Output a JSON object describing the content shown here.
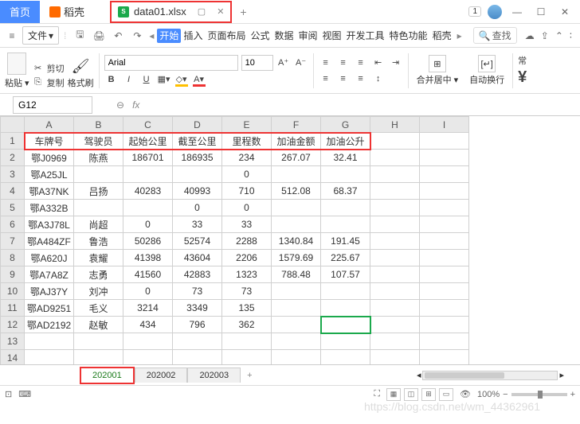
{
  "titlebar": {
    "home_tab": "首页",
    "docer_tab": "稻壳",
    "file_tab": "data01.xlsx",
    "badge": "1"
  },
  "menubar": {
    "file_menu": "文件",
    "tabs": [
      "开始",
      "插入",
      "页面布局",
      "公式",
      "数据",
      "审阅",
      "视图",
      "开发工具",
      "特色功能",
      "稻壳"
    ],
    "active_tab_index": 0,
    "search_label": "查找"
  },
  "ribbon": {
    "paste": "粘贴",
    "cut": "剪切",
    "copy": "复制",
    "format_painter": "格式刷",
    "font_name": "Arial",
    "font_size": "10",
    "merge_center": "合并居中",
    "auto_wrap": "自动换行",
    "general": "常"
  },
  "formula_bar": {
    "name_box": "G12"
  },
  "sheet": {
    "columns": [
      "A",
      "B",
      "C",
      "D",
      "E",
      "F",
      "G",
      "H",
      "I"
    ],
    "rows_shown": 15,
    "active_cell": {
      "row": 12,
      "col": "G"
    },
    "headers": [
      "车牌号",
      "驾驶员",
      "起始公里",
      "截至公里",
      "里程数",
      "加油金额",
      "加油公升"
    ],
    "data": [
      [
        "鄂J0969",
        "陈燕",
        "186701",
        "186935",
        "234",
        "267.07",
        "32.41"
      ],
      [
        "鄂A25JL",
        "",
        "",
        "",
        "0",
        "",
        ""
      ],
      [
        "鄂A37NK",
        "吕扬",
        "40283",
        "40993",
        "710",
        "512.08",
        "68.37"
      ],
      [
        "鄂A332B",
        "",
        "",
        "0",
        "0",
        "",
        ""
      ],
      [
        "鄂A3J78L",
        "尚超",
        "0",
        "33",
        "33",
        "",
        ""
      ],
      [
        "鄂A484ZF",
        "鲁浩",
        "50286",
        "52574",
        "2288",
        "1340.84",
        "191.45"
      ],
      [
        "鄂A620J",
        "袁耀",
        "41398",
        "43604",
        "2206",
        "1579.69",
        "225.67"
      ],
      [
        "鄂A7A8Z",
        "志勇",
        "41560",
        "42883",
        "1323",
        "788.48",
        "107.57"
      ],
      [
        "鄂AJ37Y",
        "刘冲",
        "0",
        "73",
        "73",
        "",
        ""
      ],
      [
        "鄂AD9251",
        "毛义",
        "3214",
        "3349",
        "135",
        "",
        ""
      ],
      [
        "鄂AD2192",
        "赵敏",
        "434",
        "796",
        "362",
        "",
        ""
      ]
    ]
  },
  "sheet_tabs": {
    "tabs": [
      "202001",
      "202002",
      "202003"
    ],
    "active_index": 0
  },
  "statusbar": {
    "zoom": "100%"
  },
  "watermark": "https://blog.csdn.net/wm_44362961"
}
